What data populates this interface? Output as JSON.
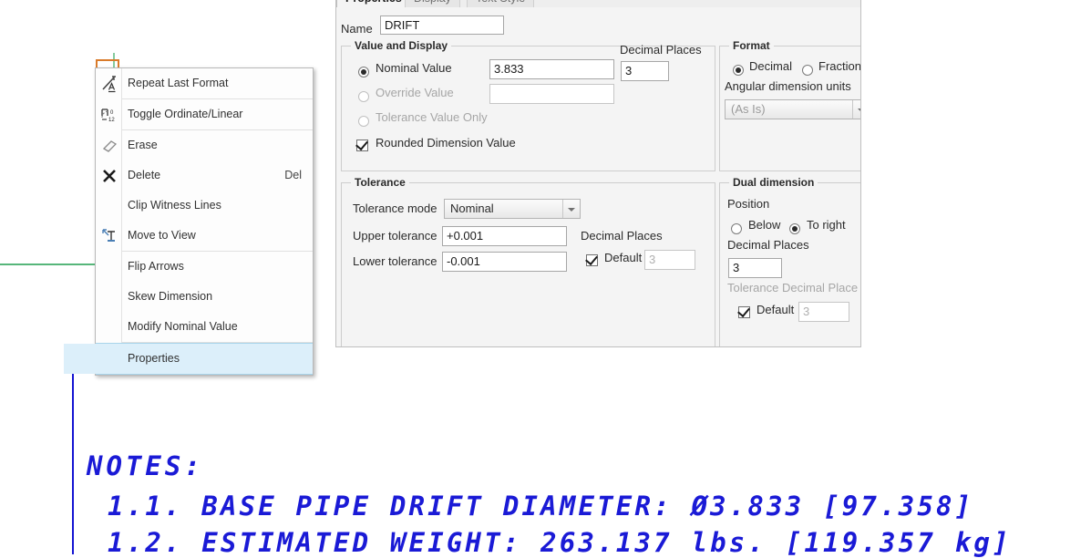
{
  "context_menu": {
    "items": [
      {
        "label": "Repeat Last Format",
        "icon": "repeat-format-icon",
        "accel": "",
        "selected": false,
        "sep_after": true
      },
      {
        "label": "Toggle Ordinate/Linear",
        "icon": "toggle-ordinate-linear-icon",
        "accel": "",
        "selected": false,
        "sep_after": true
      },
      {
        "label": "Erase",
        "icon": "eraser-icon",
        "accel": "",
        "selected": false,
        "sep_after": false
      },
      {
        "label": "Delete",
        "icon": "delete-x-icon",
        "accel": "Del",
        "selected": false,
        "sep_after": false
      },
      {
        "label": "Clip Witness Lines",
        "icon": "",
        "accel": "",
        "selected": false,
        "sep_after": false
      },
      {
        "label": "Move to View",
        "icon": "move-to-view-icon",
        "accel": "",
        "selected": false,
        "sep_after": true
      },
      {
        "label": "Flip Arrows",
        "icon": "",
        "accel": "",
        "selected": false,
        "sep_after": false
      },
      {
        "label": "Skew Dimension",
        "icon": "",
        "accel": "",
        "selected": false,
        "sep_after": false
      },
      {
        "label": "Modify Nominal Value",
        "icon": "",
        "accel": "",
        "selected": false,
        "sep_after": true
      },
      {
        "label": "Properties",
        "icon": "",
        "accel": "",
        "selected": true,
        "sep_after": false
      }
    ],
    "highlight_color": "#dcefFA"
  },
  "dialog": {
    "tabs": [
      {
        "label": "Properties",
        "active": true
      },
      {
        "label": "Display",
        "active": false
      },
      {
        "label": "Text Style",
        "active": false
      }
    ],
    "name_label": "Name",
    "name_value": "DRIFT",
    "value_display": {
      "title": "Value and Display",
      "nominal_value_label": "Nominal Value",
      "nominal_value": "3.833",
      "nominal_selected": true,
      "override_value_label": "Override Value",
      "override_value": "",
      "tolerance_value_only_label": "Tolerance Value Only",
      "rounded_dimension_label": "Rounded Dimension Value",
      "rounded_dimension_checked": true,
      "decimal_places_label": "Decimal Places",
      "decimal_places": "3"
    },
    "format": {
      "title": "Format",
      "decimal_label": "Decimal",
      "decimal_selected": true,
      "fractional_label": "Fractional",
      "angular_units_label": "Angular dimension units",
      "angular_units_value": "(As Is)"
    },
    "tolerance": {
      "title": "Tolerance",
      "mode_label": "Tolerance mode",
      "mode_value": "Nominal",
      "upper_label": "Upper tolerance",
      "upper_value": "+0.001",
      "lower_label": "Lower tolerance",
      "lower_value": "-0.001",
      "decimal_places_label": "Decimal Places",
      "default_label": "Default",
      "default_checked": true,
      "default_places": "3"
    },
    "dual_dimension": {
      "title": "Dual dimension",
      "position_label": "Position",
      "below_label": "Below",
      "to_right_label": "To right",
      "to_right_selected": true,
      "decimal_places_label": "Decimal Places",
      "decimal_places": "3",
      "tolerance_decimal_label": "Tolerance Decimal Place",
      "default_label": "Default",
      "default_checked": true,
      "default_places": "3"
    }
  },
  "notes": {
    "title": "NOTES:",
    "line_1": "1.1. BASE PIPE DRIFT DIAMETER: Ø3.833 [97.358]",
    "line_2": "1.2. ESTIMATED WEIGHT: 263.137 lbs. [119.357 kg]",
    "color": "#1a1aD6"
  },
  "canvas": {
    "green_color": "#1f9e4e",
    "orange_color": "#d97b2a"
  }
}
